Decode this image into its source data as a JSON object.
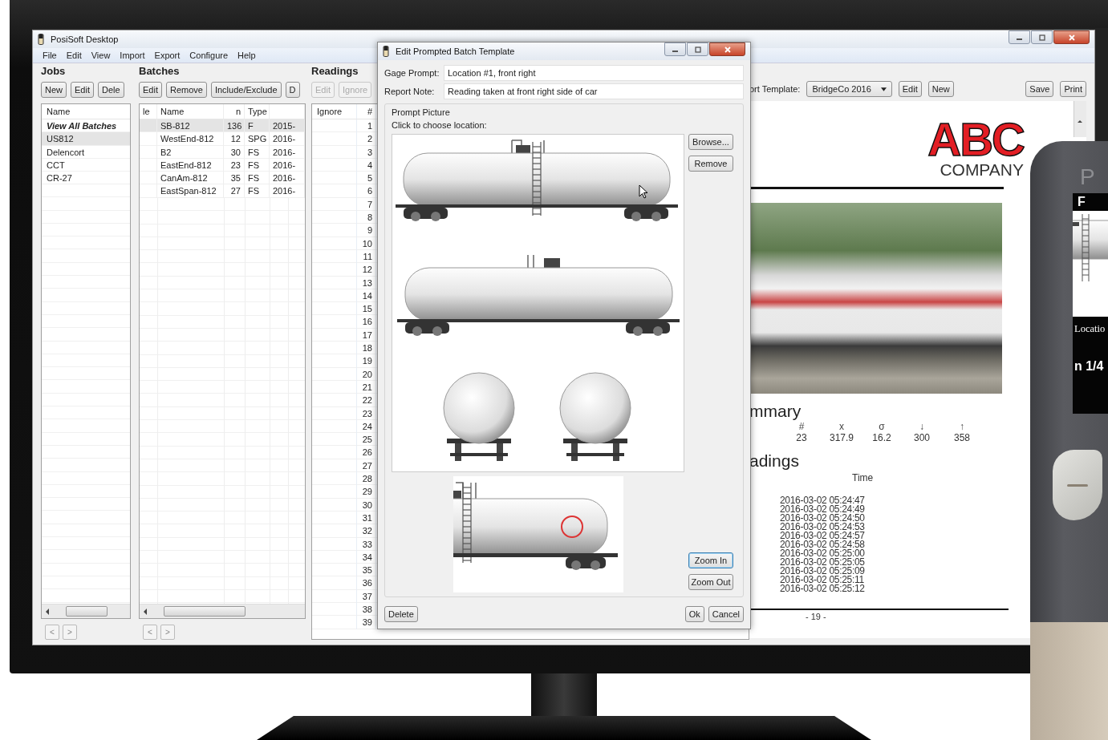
{
  "app": {
    "title": "PosiSoft Desktop",
    "menu": [
      "File",
      "Edit",
      "View",
      "Import",
      "Export",
      "Configure",
      "Help"
    ]
  },
  "jobs": {
    "heading": "Jobs",
    "buttons": [
      "New",
      "Edit",
      "Dele"
    ],
    "column": "Name",
    "rows": [
      {
        "name": "View All Batches",
        "kind": "all",
        "selected": false
      },
      {
        "name": "US812",
        "kind": "job",
        "selected": true
      },
      {
        "name": "Delencort",
        "kind": "job",
        "selected": false
      },
      {
        "name": "CCT",
        "kind": "job",
        "selected": false
      },
      {
        "name": "CR-27",
        "kind": "job",
        "selected": false
      }
    ],
    "nav": [
      "<",
      ">"
    ]
  },
  "batches": {
    "heading": "Batches",
    "buttons": [
      "Edit",
      "Remove",
      "Include/Exclude",
      "D"
    ],
    "columns": [
      "le",
      "Name",
      "n",
      "Type"
    ],
    "rows": [
      {
        "name": "SB-812",
        "n": "136",
        "type": "F",
        "date": "2015-",
        "selected": true
      },
      {
        "name": "WestEnd-812",
        "n": "12",
        "type": "SPG",
        "date": "2016-",
        "selected": false
      },
      {
        "name": "B2",
        "n": "30",
        "type": "FS",
        "date": "2016-",
        "selected": false
      },
      {
        "name": "EastEnd-812",
        "n": "23",
        "type": "FS",
        "date": "2016-",
        "selected": false
      },
      {
        "name": "CanAm-812",
        "n": "35",
        "type": "FS",
        "date": "2016-",
        "selected": false
      },
      {
        "name": "EastSpan-812",
        "n": "27",
        "type": "FS",
        "date": "2016-",
        "selected": false
      }
    ],
    "nav": [
      "<",
      ">"
    ]
  },
  "readings": {
    "heading": "Readings",
    "buttons": [
      {
        "label": "Edit",
        "disabled": true
      },
      {
        "label": "Ignore",
        "disabled": true
      }
    ],
    "columns": [
      "Ignore",
      "#"
    ],
    "rows": [
      "1",
      "2",
      "3",
      "4",
      "5",
      "6",
      "7",
      "8",
      "9",
      "10",
      "11",
      "12",
      "13",
      "14",
      "15",
      "16",
      "17",
      "18",
      "19",
      "20",
      "21",
      "22",
      "23",
      "24",
      "25",
      "26",
      "27",
      "28",
      "29",
      "30",
      "31",
      "32",
      "33",
      "34",
      "35",
      "36",
      "37",
      "38",
      "39"
    ]
  },
  "report": {
    "template_label": "ort Template:",
    "template": "BridgeCo 2016",
    "buttons": [
      "Edit",
      "New"
    ],
    "actions": [
      "Save",
      "Print"
    ],
    "page": {
      "logo_top": "ABC",
      "logo_bottom": "COMPANY",
      "summary_heading": "mmary",
      "summary_columns": [
        "#",
        "x",
        "σ",
        "↓",
        "↑"
      ],
      "summary_values": [
        "23",
        "317.9",
        "16.2",
        "300",
        "358"
      ],
      "readings_heading": "adings",
      "time_column": "Time",
      "times": [
        "2016-03-02 05:24:47",
        "2016-03-02 05:24:49",
        "2016-03-02 05:24:50",
        "2016-03-02 05:24:53",
        "2016-03-02 05:24:57",
        "2016-03-02 05:24:58",
        "2016-03-02 05:25:00",
        "2016-03-02 05:25:05",
        "2016-03-02 05:25:09",
        "2016-03-02 05:25:11",
        "2016-03-02 05:25:12"
      ],
      "page_number": "- 19 -"
    }
  },
  "dialog": {
    "title": "Edit Prompted Batch Template",
    "fields": [
      {
        "label": "Gage Prompt:",
        "value": "Location #1, front right"
      },
      {
        "label": "Report Note:",
        "value": "Reading taken at front right side of car"
      }
    ],
    "group": "Prompt Picture",
    "instruction": "Click to choose location:",
    "side_buttons": [
      "Browse...",
      "Remove"
    ],
    "zoom_buttons": [
      {
        "label": "Zoom In",
        "selected": true
      },
      {
        "label": "Zoom Out",
        "selected": false
      }
    ],
    "delete": "Delete",
    "ok": "Ok",
    "cancel": "Cancel"
  },
  "gauge": {
    "brand": "P",
    "mode": "F",
    "prompt": "Locatio",
    "count": "n 1/4"
  }
}
